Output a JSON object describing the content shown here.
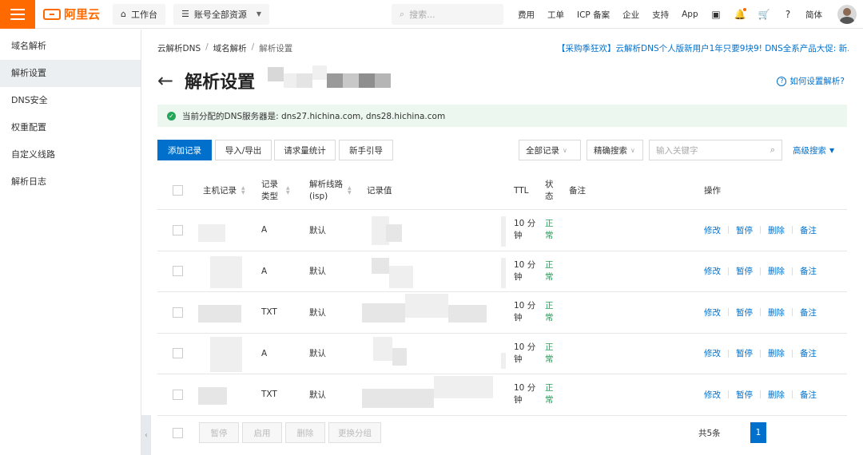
{
  "topbar": {
    "brand": "阿里云",
    "workbench": "工作台",
    "account_scope": "账号全部资源",
    "search_placeholder": "搜索...",
    "links": [
      "费用",
      "工单",
      "ICP 备案",
      "企业",
      "支持",
      "App"
    ],
    "lang": "简体",
    "accent_color": "#ff6a00"
  },
  "sidebar": {
    "items": [
      {
        "label": "域名解析",
        "active": false
      },
      {
        "label": "解析设置",
        "active": true
      },
      {
        "label": "DNS安全",
        "active": false
      },
      {
        "label": "权重配置",
        "active": false
      },
      {
        "label": "自定义线路",
        "active": false
      },
      {
        "label": "解析日志",
        "active": false
      }
    ]
  },
  "breadcrumb": [
    "云解析DNS",
    "域名解析",
    "解析设置"
  ],
  "promo": "【采购季狂欢】云解析DNS个人版新用户1年只要9块9! DNS全系产品大促: 新...",
  "page_title": "解析设置",
  "help_link": "如何设置解析?",
  "notice": "当前分配的DNS服务器是: dns27.hichina.com, dns28.hichina.com",
  "toolbar": {
    "add": "添加记录",
    "import_export": "导入/导出",
    "stats": "请求量统计",
    "guide": "新手引导",
    "record_filter": "全部记录",
    "search_mode": "精确搜索",
    "keyword_placeholder": "输入关键字",
    "advanced": "高级搜索"
  },
  "table": {
    "headers": {
      "host": "主机记录",
      "type_line1": "记录",
      "type_line2": "类型",
      "line_line1": "解析线路",
      "line_line2": "(isp)",
      "value": "记录值",
      "ttl": "TTL",
      "status_line1": "状",
      "status_line2": "态",
      "remark": "备注",
      "ops": "操作"
    },
    "rows": [
      {
        "type": "A",
        "line": "默认",
        "ttl1": "10 分",
        "ttl2": "钟",
        "status1": "正",
        "status2": "常"
      },
      {
        "type": "A",
        "line": "默认",
        "ttl1": "10 分",
        "ttl2": "钟",
        "status1": "正",
        "status2": "常"
      },
      {
        "type": "TXT",
        "line": "默认",
        "ttl1": "10 分",
        "ttl2": "钟",
        "status1": "正",
        "status2": "常"
      },
      {
        "type": "A",
        "line": "默认",
        "ttl1": "10 分",
        "ttl2": "钟",
        "status1": "正",
        "status2": "常"
      },
      {
        "type": "TXT",
        "line": "默认",
        "ttl1": "10 分",
        "ttl2": "钟",
        "status1": "正",
        "status2": "常"
      }
    ],
    "ops": {
      "edit": "修改",
      "pause": "暂停",
      "delete": "删除",
      "remark": "备注"
    }
  },
  "footer": {
    "pause": "暂停",
    "enable": "启用",
    "delete": "删除",
    "change_group": "更换分组",
    "total": "共5条",
    "page": "1"
  }
}
